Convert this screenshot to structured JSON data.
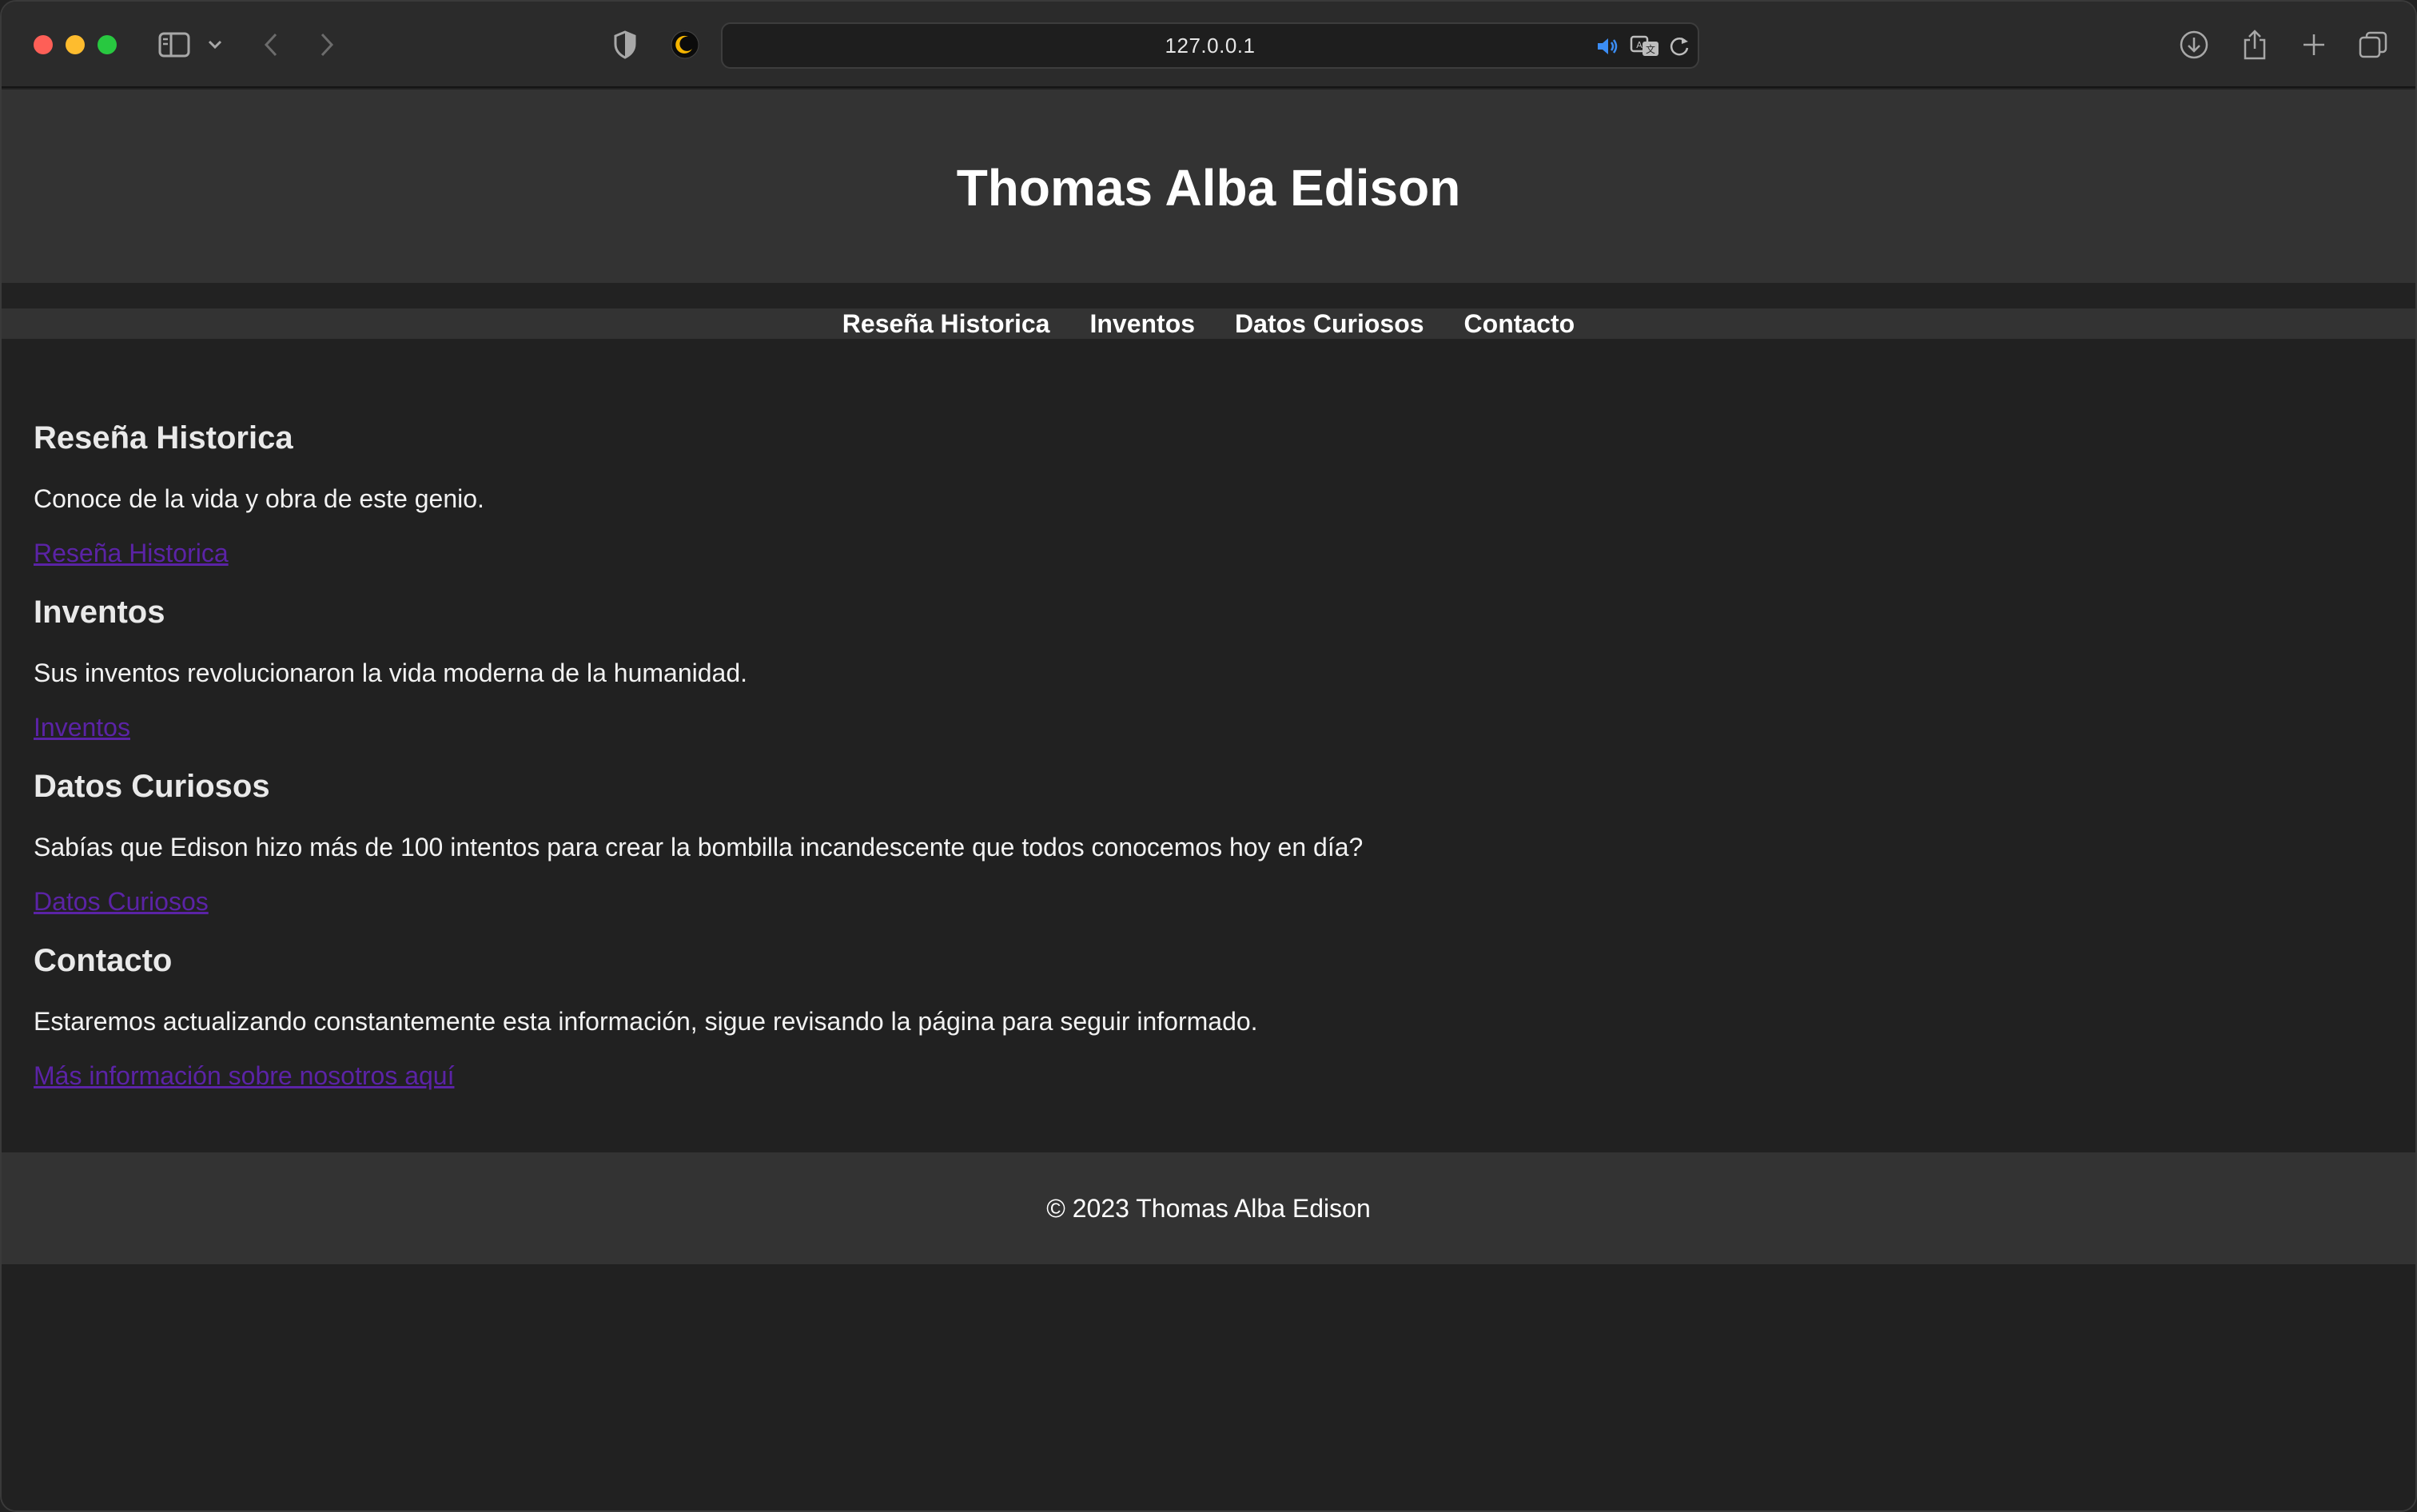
{
  "browser": {
    "url": "127.0.0.1"
  },
  "site": {
    "title": "Thomas Alba Edison",
    "nav": [
      {
        "label": "Reseña Historica"
      },
      {
        "label": "Inventos"
      },
      {
        "label": "Datos Curiosos"
      },
      {
        "label": "Contacto"
      }
    ],
    "sections": [
      {
        "heading": "Reseña Historica",
        "text": "Conoce de la vida y obra de este genio.",
        "link": "Reseña Historica"
      },
      {
        "heading": "Inventos",
        "text": "Sus inventos revolucionaron la vida moderna de la humanidad.",
        "link": "Inventos"
      },
      {
        "heading": "Datos Curiosos",
        "text": "Sabías que Edison hizo más de 100 intentos para crear la bombilla incandescente que todos conocemos hoy en día?",
        "link": "Datos Curiosos"
      },
      {
        "heading": "Contacto",
        "text": "Estaremos actualizando constantemente esta información, sigue revisando la página para seguir informado.",
        "link": "Más información sobre nosotros aquí"
      }
    ],
    "footer": "© 2023 Thomas Alba Edison"
  },
  "colors": {
    "header_bg": "#333333",
    "page_bg": "#212121",
    "link": "#5b23a6"
  }
}
